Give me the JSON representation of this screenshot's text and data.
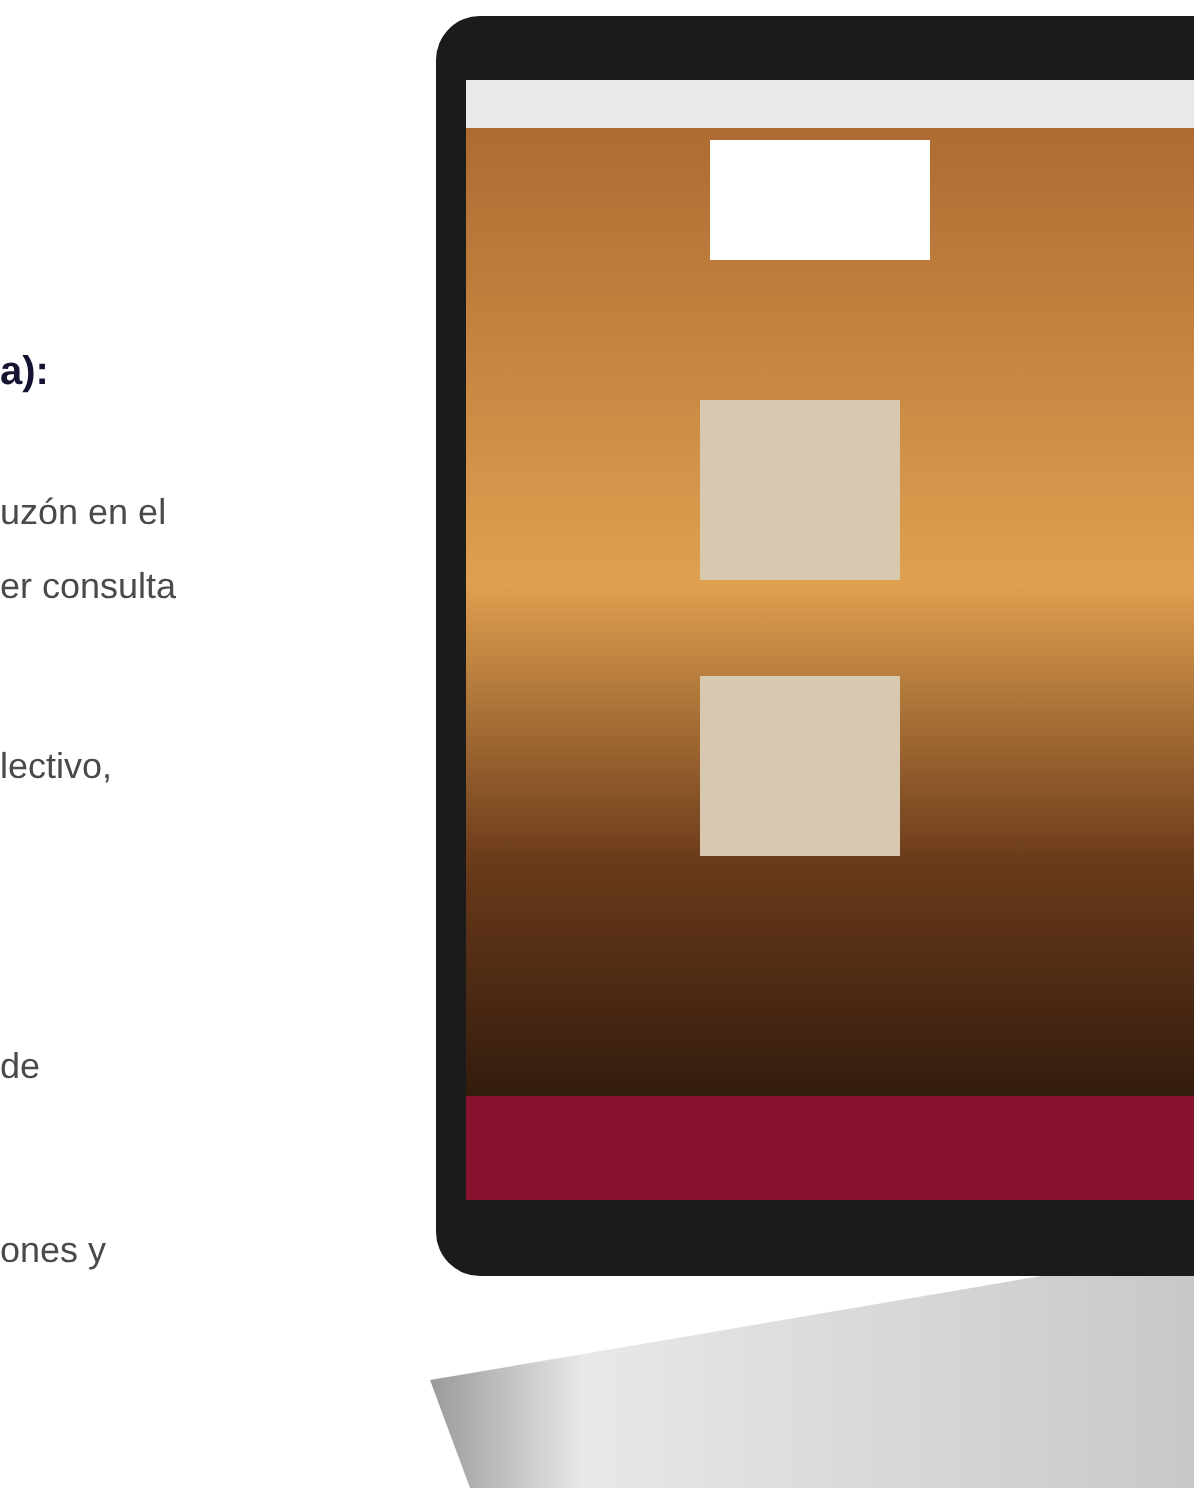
{
  "heading": "a):",
  "lines": [
    "uzón en el",
    "er consulta",
    "lectivo,",
    "de",
    "ones y"
  ]
}
